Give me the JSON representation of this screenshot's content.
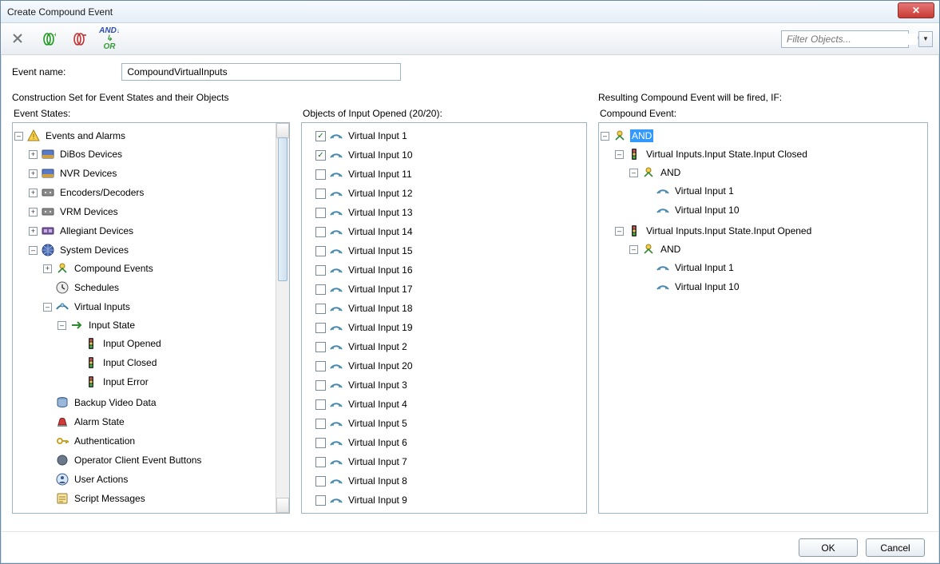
{
  "window": {
    "title": "Create Compound Event",
    "close_label": "✕"
  },
  "toolbar": {
    "filter_placeholder": "Filter Objects..."
  },
  "labels": {
    "event_name": "Event name:",
    "construction": "Construction Set for Event States and their Objects",
    "event_states": "Event States:",
    "objects_of": "Objects of Input Opened (20/20):",
    "resulting": "Resulting Compound Event will be fired, IF:",
    "compound_event": "Compound Event:"
  },
  "event_name_value": "CompoundVirtualInputs",
  "tree": {
    "root": "Events and Alarms",
    "dibos": "DiBos Devices",
    "nvr": "NVR Devices",
    "encdec": "Encoders/Decoders",
    "vrm": "VRM Devices",
    "allegiant": "Allegiant Devices",
    "system": "System Devices",
    "compound_events": "Compound Events",
    "schedules": "Schedules",
    "virtual_inputs": "Virtual Inputs",
    "input_state": "Input State",
    "input_opened": "Input Opened",
    "input_closed": "Input Closed",
    "input_error": "Input Error",
    "backup_video": "Backup Video Data",
    "alarm_state": "Alarm State",
    "authentication": "Authentication",
    "op_client": "Operator Client Event Buttons",
    "user_actions": "User Actions",
    "script_messages": "Script Messages"
  },
  "objects": [
    {
      "label": "Virtual Input 1",
      "checked": true
    },
    {
      "label": "Virtual Input 10",
      "checked": true
    },
    {
      "label": "Virtual Input 11",
      "checked": false
    },
    {
      "label": "Virtual Input 12",
      "checked": false
    },
    {
      "label": "Virtual Input 13",
      "checked": false
    },
    {
      "label": "Virtual Input 14",
      "checked": false
    },
    {
      "label": "Virtual Input 15",
      "checked": false
    },
    {
      "label": "Virtual Input 16",
      "checked": false
    },
    {
      "label": "Virtual Input 17",
      "checked": false
    },
    {
      "label": "Virtual Input 18",
      "checked": false
    },
    {
      "label": "Virtual Input 19",
      "checked": false
    },
    {
      "label": "Virtual Input 2",
      "checked": false
    },
    {
      "label": "Virtual Input 20",
      "checked": false
    },
    {
      "label": "Virtual Input 3",
      "checked": false
    },
    {
      "label": "Virtual Input 4",
      "checked": false
    },
    {
      "label": "Virtual Input 5",
      "checked": false
    },
    {
      "label": "Virtual Input 6",
      "checked": false
    },
    {
      "label": "Virtual Input 7",
      "checked": false
    },
    {
      "label": "Virtual Input 8",
      "checked": false
    },
    {
      "label": "Virtual Input 9",
      "checked": false
    }
  ],
  "result_tree": {
    "and_root": "AND",
    "closed": "Virtual Inputs.Input State.Input Closed",
    "and_sub1": "AND",
    "vi1": "Virtual Input 1",
    "vi10": "Virtual Input 10",
    "opened": "Virtual Inputs.Input State.Input Opened",
    "and_sub2": "AND",
    "vi1b": "Virtual Input 1",
    "vi10b": "Virtual Input 10"
  },
  "footer": {
    "ok": "OK",
    "cancel": "Cancel"
  }
}
